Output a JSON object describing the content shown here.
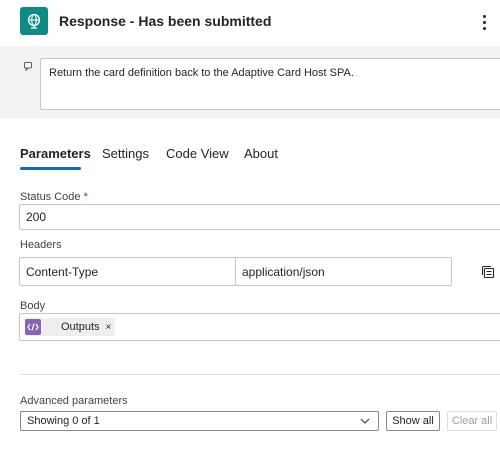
{
  "header": {
    "title": "Response - Has been submitted",
    "app_icon": "globe-icon",
    "accent": "#0c8c84"
  },
  "description": {
    "text": "Return the card definition back to the Adaptive Card Host SPA."
  },
  "tabs": [
    {
      "label": "Parameters",
      "active": true
    },
    {
      "label": "Settings",
      "active": false
    },
    {
      "label": "Code View",
      "active": false
    },
    {
      "label": "About",
      "active": false
    }
  ],
  "status_code": {
    "label": "Status Code",
    "required_mark": "*",
    "value": "200"
  },
  "headers": {
    "label": "Headers",
    "key": "Content-Type",
    "value": "application/json"
  },
  "body": {
    "label": "Body",
    "token": {
      "label": "Outputs",
      "remove": "×",
      "color": "#8764b8"
    }
  },
  "advanced": {
    "label": "Advanced parameters",
    "select_value": "Showing 0 of 1",
    "show_all": "Show all",
    "clear_all": "Clear all"
  }
}
